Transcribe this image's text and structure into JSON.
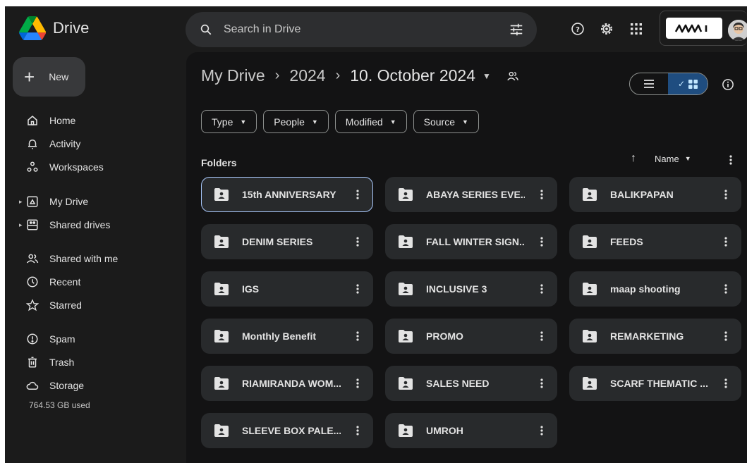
{
  "app": {
    "name": "Drive"
  },
  "search": {
    "placeholder": "Search in Drive"
  },
  "account": {
    "org_logo_text": "ЛЛЛI"
  },
  "sidebar": {
    "new_label": "New",
    "items": [
      {
        "label": "Home",
        "icon": "home-icon"
      },
      {
        "label": "Activity",
        "icon": "bell-icon"
      },
      {
        "label": "Workspaces",
        "icon": "workspaces-icon"
      },
      {
        "label": "My Drive",
        "icon": "my-drive-icon"
      },
      {
        "label": "Shared drives",
        "icon": "shared-drives-icon"
      },
      {
        "label": "Shared with me",
        "icon": "people-icon"
      },
      {
        "label": "Recent",
        "icon": "clock-icon"
      },
      {
        "label": "Starred",
        "icon": "star-icon"
      },
      {
        "label": "Spam",
        "icon": "spam-icon"
      },
      {
        "label": "Trash",
        "icon": "trash-icon"
      },
      {
        "label": "Storage",
        "icon": "cloud-icon"
      }
    ],
    "storage_used": "764.53 GB used"
  },
  "breadcrumb": {
    "root": "My Drive",
    "year": "2024",
    "current": "10. October 2024"
  },
  "filters": [
    "Type",
    "People",
    "Modified",
    "Source"
  ],
  "section": {
    "title": "Folders",
    "sort_label": "Name"
  },
  "folders": [
    "15th ANNIVERSARY",
    "ABAYA SERIES EVE...",
    "BALIKPAPAN",
    "DENIM SERIES",
    "FALL WINTER SIGN...",
    "FEEDS",
    "IGS",
    "INCLUSIVE 3",
    "maap shooting",
    "Monthly Benefit",
    "PROMO",
    "REMARKETING",
    "RIAMIRANDA WOM...",
    "SALES NEED",
    "SCARF THEMATIC ...",
    "SLEEVE BOX PALE...",
    "UMROH"
  ],
  "colors": {
    "selected_border": "#a8c7fa",
    "grid_toggle_bg": "#1f4d80",
    "card_bg": "#282a2c"
  }
}
